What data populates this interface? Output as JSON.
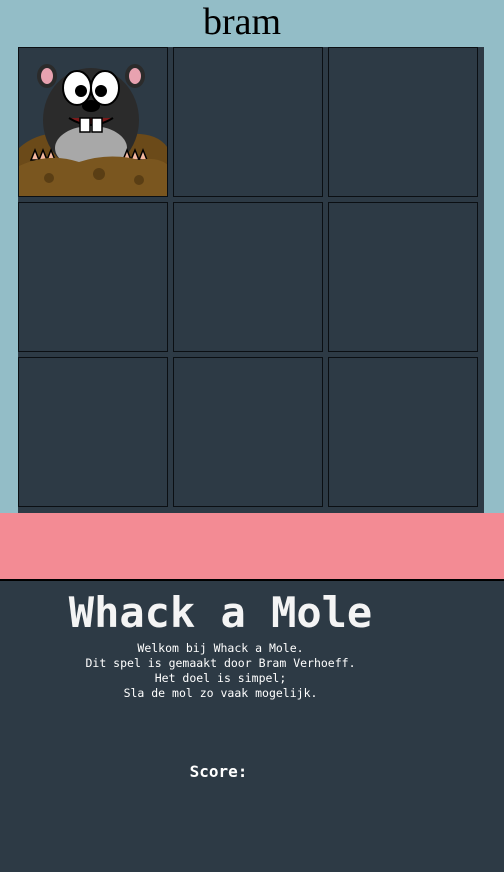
{
  "player": {
    "name": "bram"
  },
  "board": {
    "rows": 3,
    "cols": 3,
    "mole_position": 1,
    "holes": [
      1,
      2,
      3,
      4,
      5,
      6,
      7,
      8,
      9
    ]
  },
  "game": {
    "title": "Whack a Mole",
    "intro_lines": [
      "Welkom bij Whack a Mole.",
      "Dit spel is gemaakt door Bram Verhoeff.",
      "Het doel is simpel;",
      "Sla de mol zo vaak mogelijk."
    ],
    "score_label": "Score:",
    "score_value": ""
  },
  "colors": {
    "top_background": "#93bdc7",
    "hole": "#2d3a45",
    "accent_bar": "#f38b94",
    "bottom_background": "#2d3a45",
    "text": "#ffffff"
  },
  "icons": {
    "mole": "mole-icon"
  }
}
